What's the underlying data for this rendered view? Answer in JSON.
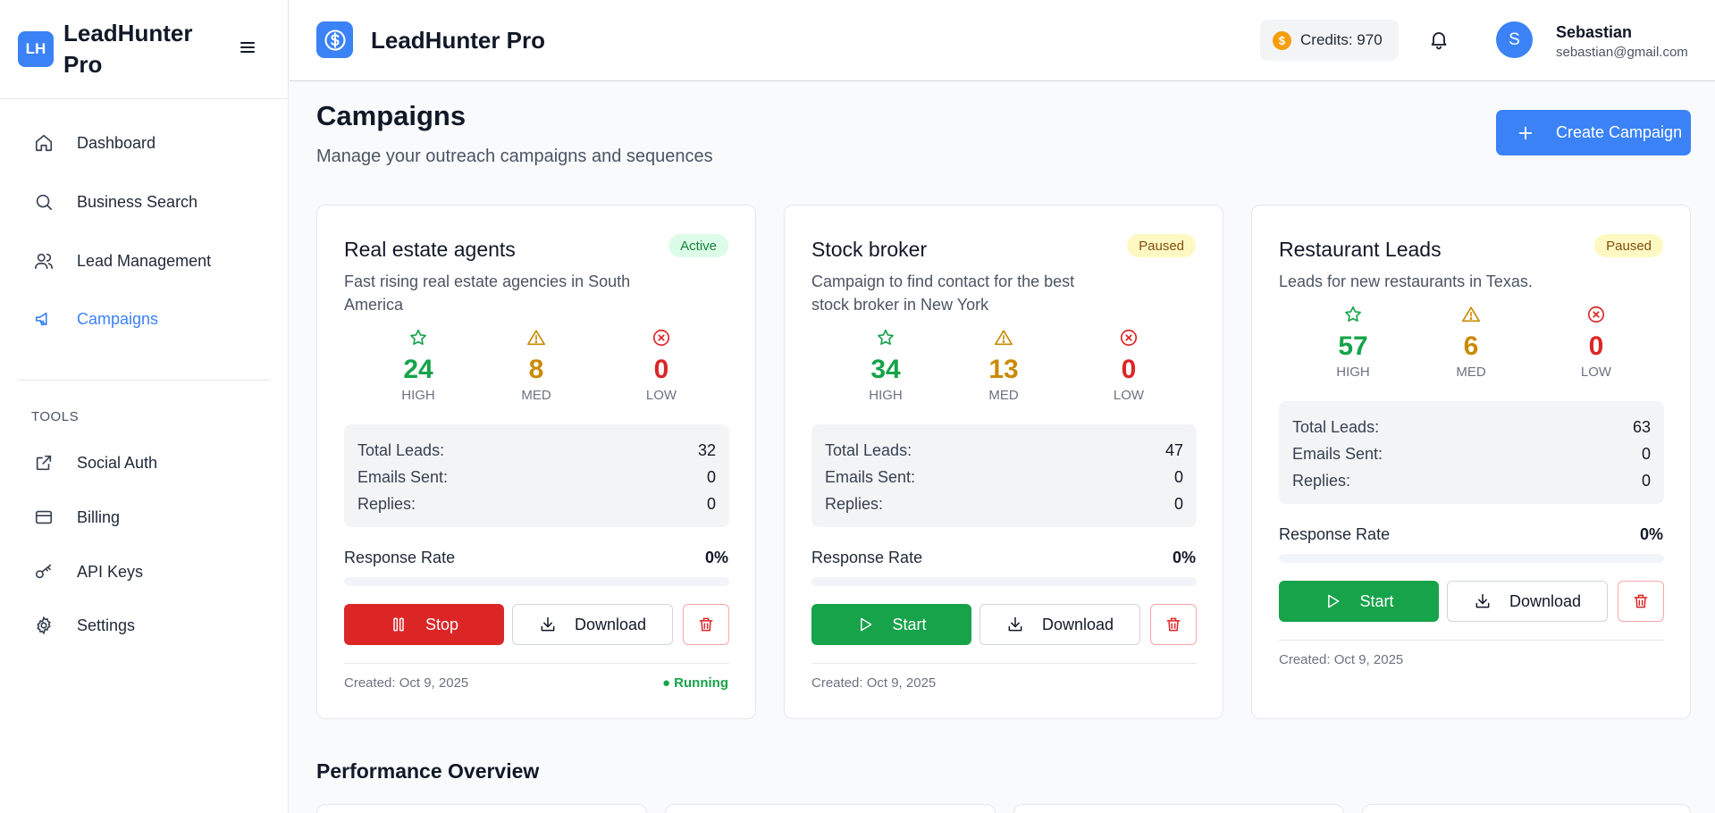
{
  "sidebar": {
    "logo_initials": "LH",
    "app_name": "LeadHunter Pro",
    "items": [
      {
        "label": "Dashboard"
      },
      {
        "label": "Business Search"
      },
      {
        "label": "Lead Management"
      },
      {
        "label": "Campaigns"
      }
    ],
    "tools_heading": "TOOLS",
    "tools": [
      {
        "label": "Social Auth"
      },
      {
        "label": "Billing"
      },
      {
        "label": "API Keys"
      },
      {
        "label": "Settings"
      }
    ]
  },
  "header": {
    "title": "LeadHunter Pro",
    "credits_symbol": "$",
    "credits": "Credits: 970",
    "user": {
      "initial": "S",
      "name": "Sebastian",
      "email": "sebastian@gmail.com"
    }
  },
  "page": {
    "title": "Campaigns",
    "subtitle": "Manage your outreach campaigns and sequences",
    "create_button": "Create Campaign",
    "performance_title": "Performance Overview"
  },
  "labels": {
    "high": "HIGH",
    "med": "MED",
    "low": "LOW",
    "total_leads": "Total Leads:",
    "emails_sent": "Emails Sent:",
    "replies": "Replies:",
    "response_rate": "Response Rate",
    "stop": "Stop",
    "start": "Start",
    "download": "Download"
  },
  "campaigns": [
    {
      "title": "Real estate agents",
      "status": "Active",
      "description": "Fast rising real estate agencies in South America",
      "high": "24",
      "med": "8",
      "low": "0",
      "total_leads": "32",
      "emails_sent": "0",
      "replies": "0",
      "response_rate": "0%",
      "response_rate_fraction": 0,
      "created": "Created: Oct 9, 2025",
      "running": "● Running"
    },
    {
      "title": "Stock broker",
      "status": "Paused",
      "description": "Campaign to find contact for the best stock broker in New York",
      "high": "34",
      "med": "13",
      "low": "0",
      "total_leads": "47",
      "emails_sent": "0",
      "replies": "0",
      "response_rate": "0%",
      "response_rate_fraction": 0,
      "created": "Created: Oct 9, 2025"
    },
    {
      "title": "Restaurant Leads",
      "status": "Paused",
      "description": "Leads for new restaurants in Texas.",
      "high": "57",
      "med": "6",
      "low": "0",
      "total_leads": "63",
      "emails_sent": "0",
      "replies": "0",
      "response_rate": "0%",
      "response_rate_fraction": 0,
      "created": "Created: Oct 9, 2025"
    }
  ],
  "colors": {
    "accent": "#3b82f6",
    "success": "#16a34a",
    "warning": "#ca8a04",
    "danger": "#dc2626"
  }
}
